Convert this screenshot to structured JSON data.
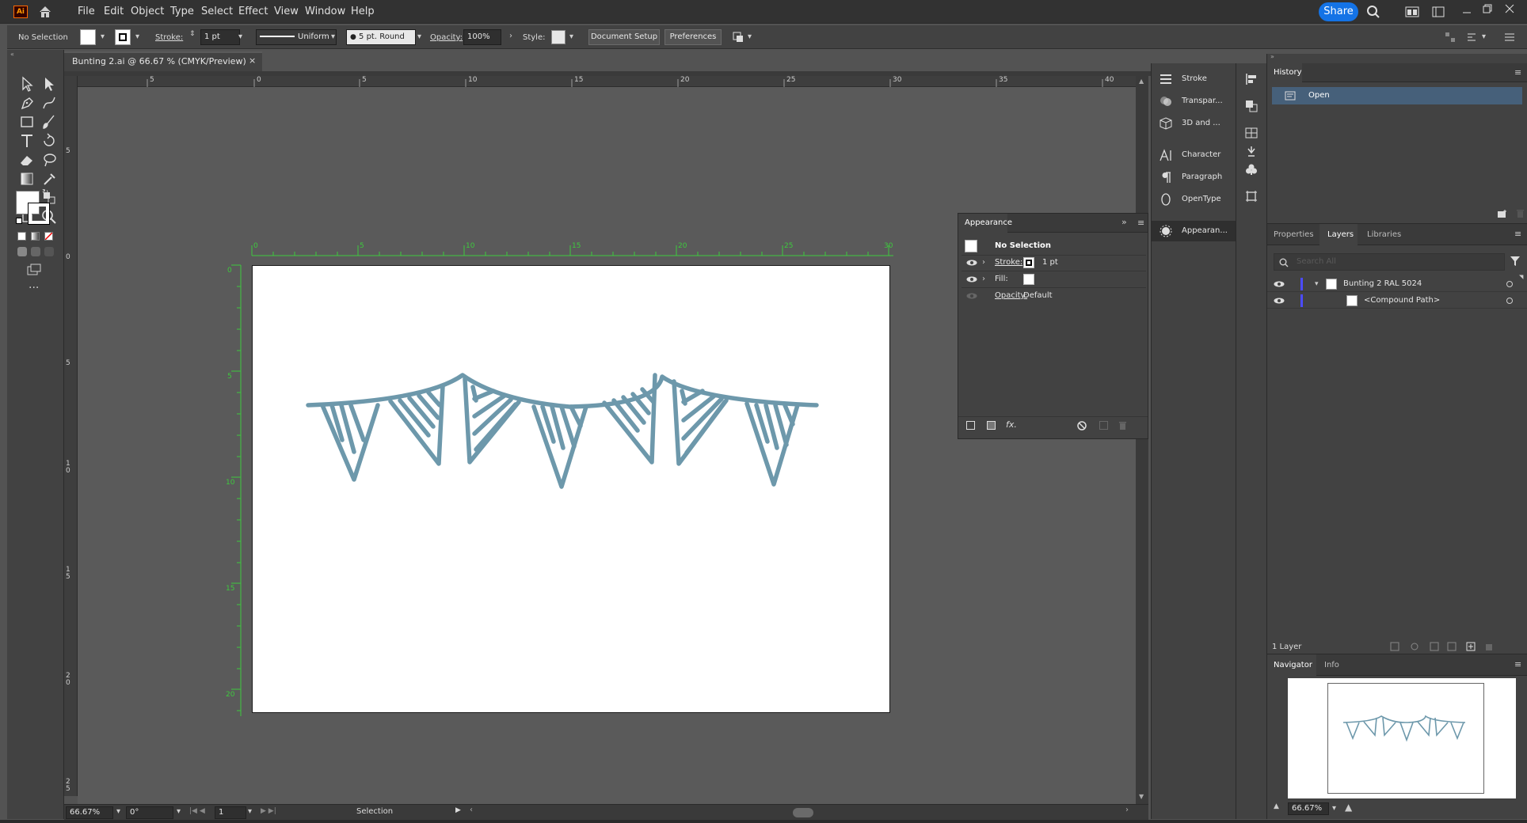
{
  "app": {
    "logo_text": "Ai",
    "accent": "#1473e6",
    "artwork_color": "#6d98ab"
  },
  "menubar": {
    "items": [
      "File",
      "Edit",
      "Object",
      "Type",
      "Select",
      "Effect",
      "View",
      "Window",
      "Help"
    ],
    "share_label": "Share"
  },
  "control_bar": {
    "selection_label": "No Selection",
    "stroke_label": "Stroke:",
    "stroke_weight": "1 pt",
    "profile": "Uniform",
    "brush": "5 pt. Round",
    "opacity_label": "Opacity:",
    "opacity_value": "100%",
    "style_label": "Style:",
    "document_setup": "Document Setup",
    "preferences": "Preferences"
  },
  "document": {
    "tab_title": "Bunting 2.ai @ 66.67 % (CMYK/Preview)",
    "close_glyph": "×"
  },
  "rulers": {
    "horizontal_ticks": [
      "5",
      "0",
      "5",
      "10",
      "15",
      "20",
      "25",
      "30",
      "35",
      "40"
    ],
    "vertical_ticks": [
      "5",
      "0",
      "5",
      "1\n0",
      "1\n5",
      "2\n0",
      "2\n5"
    ],
    "artboard_h_ticks": [
      "0",
      "5",
      "10",
      "15",
      "20",
      "25",
      "30"
    ],
    "artboard_v_ticks": [
      "0",
      "5",
      "10",
      "15",
      "20"
    ]
  },
  "statusbar": {
    "zoom": "66.67%",
    "rotation": "0°",
    "artboard_number": "1",
    "tool_name": "Selection"
  },
  "dock": {
    "items": [
      {
        "label": "Stroke",
        "icon": "stroke-icon"
      },
      {
        "label": "Transpar...",
        "icon": "transparency-icon"
      },
      {
        "label": "3D and ...",
        "icon": "3d-cube-icon"
      },
      {
        "label": "Character",
        "icon": "character-icon"
      },
      {
        "label": "Paragraph",
        "icon": "paragraph-icon"
      },
      {
        "label": "OpenType",
        "icon": "opentype-icon"
      },
      {
        "label": "Appearan...",
        "icon": "appearance-icon"
      }
    ]
  },
  "appearance_panel": {
    "title": "Appearance",
    "selection": "No Selection",
    "stroke_label": "Stroke:",
    "stroke_value": "1 pt",
    "fill_label": "Fill:",
    "opacity_label": "Opacity:",
    "opacity_value": "Default",
    "fx_label": "fx."
  },
  "history_panel": {
    "title": "History",
    "items": [
      "Open"
    ]
  },
  "layers_panel": {
    "tabs": [
      "Properties",
      "Layers",
      "Libraries"
    ],
    "active_tab": "Layers",
    "search_placeholder": "Search All",
    "layers": [
      {
        "name": "Bunting 2 RAL 5024"
      },
      {
        "name": "<Compound Path>"
      }
    ],
    "footer": "1 Layer"
  },
  "navigator_panel": {
    "tabs": [
      "Navigator",
      "Info"
    ],
    "zoom": "66.67%"
  }
}
